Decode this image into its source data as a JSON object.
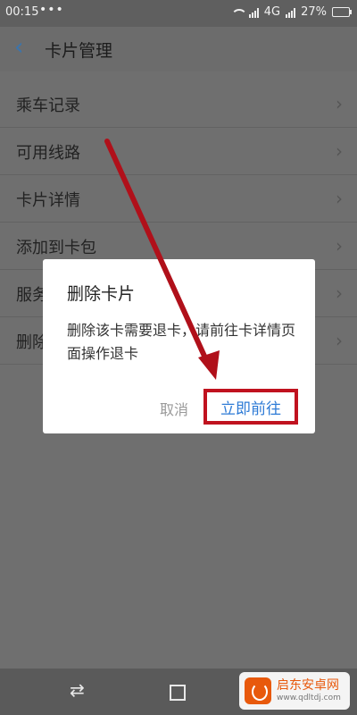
{
  "status_bar": {
    "time": "00:15",
    "dots": "•••",
    "network": "4G",
    "battery": "27%"
  },
  "header": {
    "title": "卡片管理"
  },
  "menu": [
    {
      "label": "乘车记录"
    },
    {
      "label": "可用线路"
    },
    {
      "label": "卡片详情"
    },
    {
      "label": "添加到卡包"
    },
    {
      "label": "服务"
    },
    {
      "label": "删除"
    }
  ],
  "dialog": {
    "title": "删除卡片",
    "message": "删除该卡需要退卡，请前往卡详情页面操作退卡",
    "cancel": "取消",
    "confirm": "立即前往"
  },
  "watermark": {
    "main": "启东安卓网",
    "sub": "www.qdltdj.com"
  },
  "colors": {
    "accent": "#2e7bd6",
    "highlight": "#c0121f"
  },
  "icons": [
    "back-arrow-icon",
    "chevron-right-icon",
    "wifi-icon",
    "signal-icon",
    "battery-icon",
    "recent-apps-icon",
    "home-square-icon"
  ]
}
